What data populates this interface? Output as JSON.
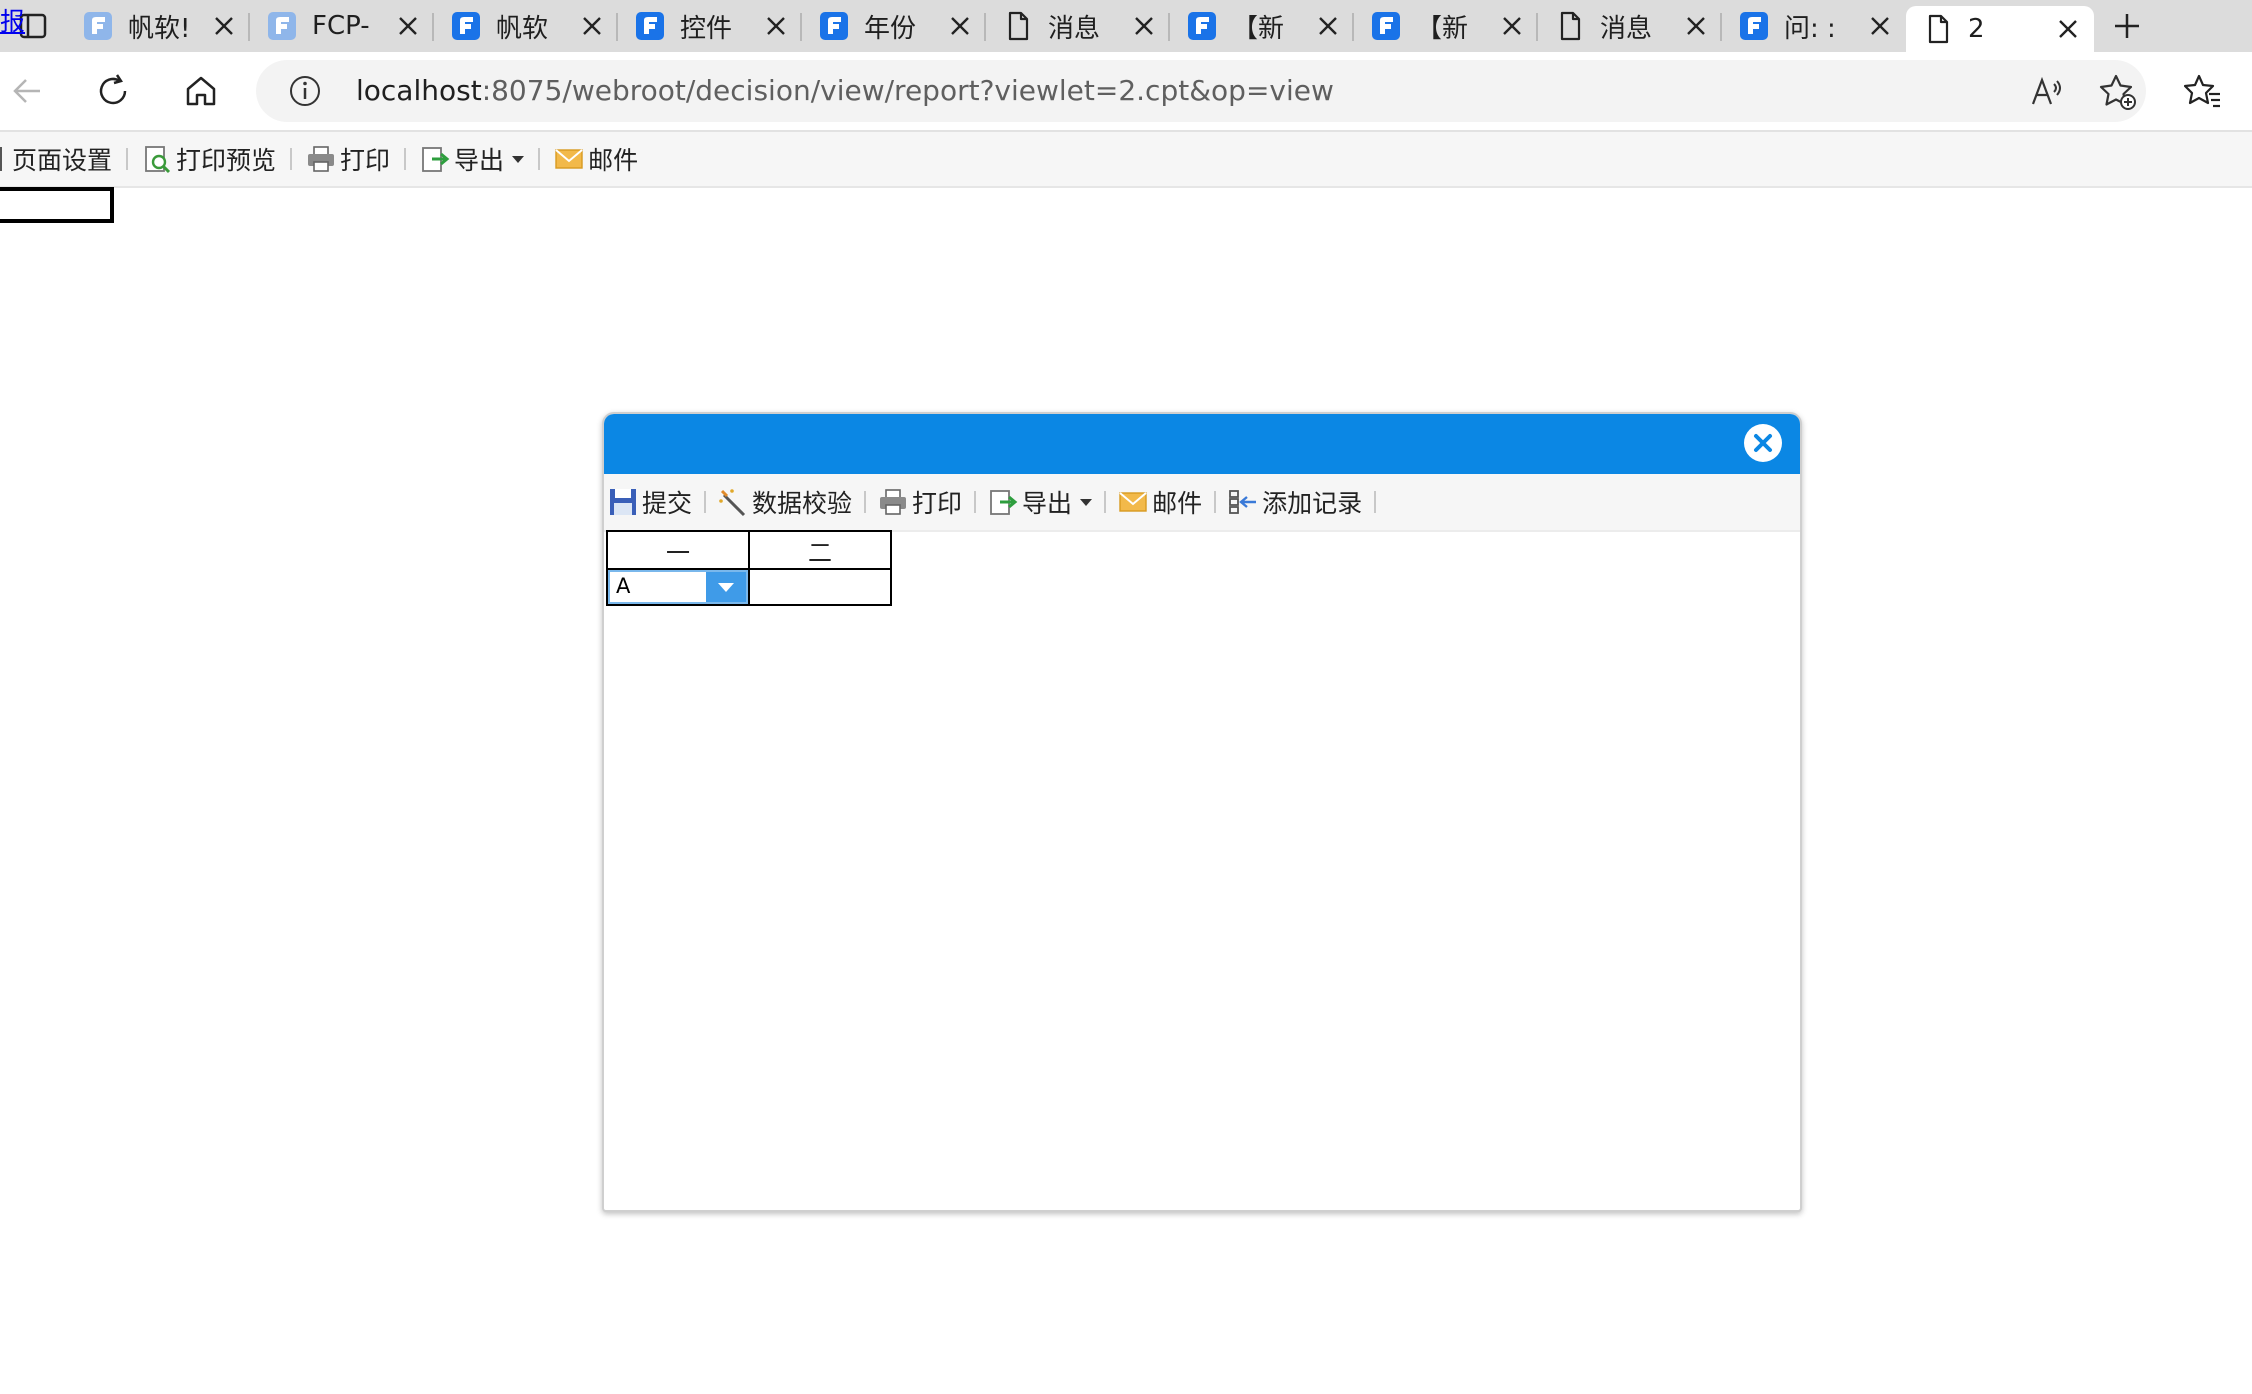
{
  "browser": {
    "tabs": [
      {
        "title": "帆软!",
        "icon": "fanruan-icon",
        "faded": true
      },
      {
        "title": "FCP-",
        "icon": "fanruan-icon",
        "faded": true
      },
      {
        "title": "帆软",
        "icon": "fanruan-icon",
        "faded": false
      },
      {
        "title": "控件",
        "icon": "fanruan-icon",
        "faded": false
      },
      {
        "title": "年份",
        "icon": "fanruan-icon",
        "faded": false
      },
      {
        "title": "消息",
        "icon": "page-icon",
        "faded": false
      },
      {
        "title": "【新",
        "icon": "fanruan-icon",
        "faded": false
      },
      {
        "title": "【新",
        "icon": "fanruan-icon",
        "faded": false
      },
      {
        "title": "消息",
        "icon": "page-icon",
        "faded": false
      },
      {
        "title": "问: :",
        "icon": "fanruan-icon",
        "faded": false
      },
      {
        "title": "2",
        "icon": "page-icon",
        "faded": false,
        "active": true
      }
    ],
    "url_host": "localhost",
    "url_rest": ":8075/webroot/decision/view/report?viewlet=2.cpt&op=view"
  },
  "report_toolbar": {
    "page_setup": "页面设置",
    "print_preview": "打印预览",
    "print": "打印",
    "export": "导出",
    "email": "邮件"
  },
  "report_link": "报",
  "dialog": {
    "toolbar": {
      "submit": "提交",
      "validate": "数据校验",
      "print": "打印",
      "export": "导出",
      "email": "邮件",
      "add_record": "添加记录"
    },
    "grid": {
      "headers": [
        "一",
        "二"
      ],
      "combo_value": "A"
    }
  },
  "colors": {
    "dialog_header": "#0b87e4",
    "combo_button": "#3f9be8",
    "fanruan_blue": "#1a73e8"
  }
}
